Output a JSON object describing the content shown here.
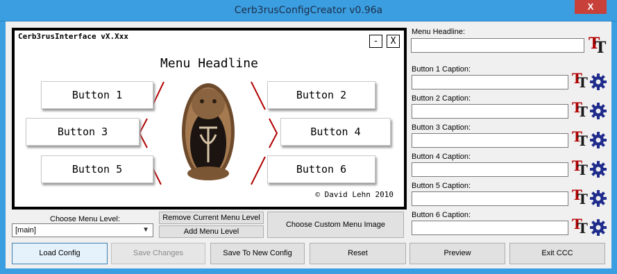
{
  "window": {
    "title": "Cerb3rusConfigCreator v0.96a",
    "close_glyph": "X"
  },
  "preview": {
    "interface_title": "Cerb3rusInterface vX.Xxx",
    "min_glyph": "-",
    "close_glyph": "X",
    "headline": "Menu Headline",
    "buttons": [
      "Button 1",
      "Button 2",
      "Button 3",
      "Button 4",
      "Button 5",
      "Button 6"
    ],
    "copyright": "© David Lehn 2010",
    "accent_color": "#b00000"
  },
  "controls": {
    "menu_level_label": "Choose Menu Level:",
    "menu_level_value": "[main]",
    "remove_level": "Remove Current Menu Level",
    "add_level": "Add Menu Level",
    "choose_image": "Choose Custom Menu Image"
  },
  "right": {
    "headline_label": "Menu Headline:",
    "headline_value": "",
    "captions": [
      {
        "label": "Button 1 Caption:",
        "value": ""
      },
      {
        "label": "Button 2 Caption:",
        "value": ""
      },
      {
        "label": "Button 3 Caption:",
        "value": ""
      },
      {
        "label": "Button 4 Caption:",
        "value": ""
      },
      {
        "label": "Button 5 Caption:",
        "value": ""
      },
      {
        "label": "Button 6 Caption:",
        "value": ""
      }
    ],
    "icon_names": [
      "text-format-icon",
      "gear-icon"
    ],
    "icon_letter_a": "T",
    "icon_letter_b": "T"
  },
  "bottom": {
    "load": "Load Config",
    "save": "Save Changes",
    "save_new": "Save To New Config",
    "reset": "Reset",
    "preview": "Preview",
    "exit": "Exit CCC"
  }
}
